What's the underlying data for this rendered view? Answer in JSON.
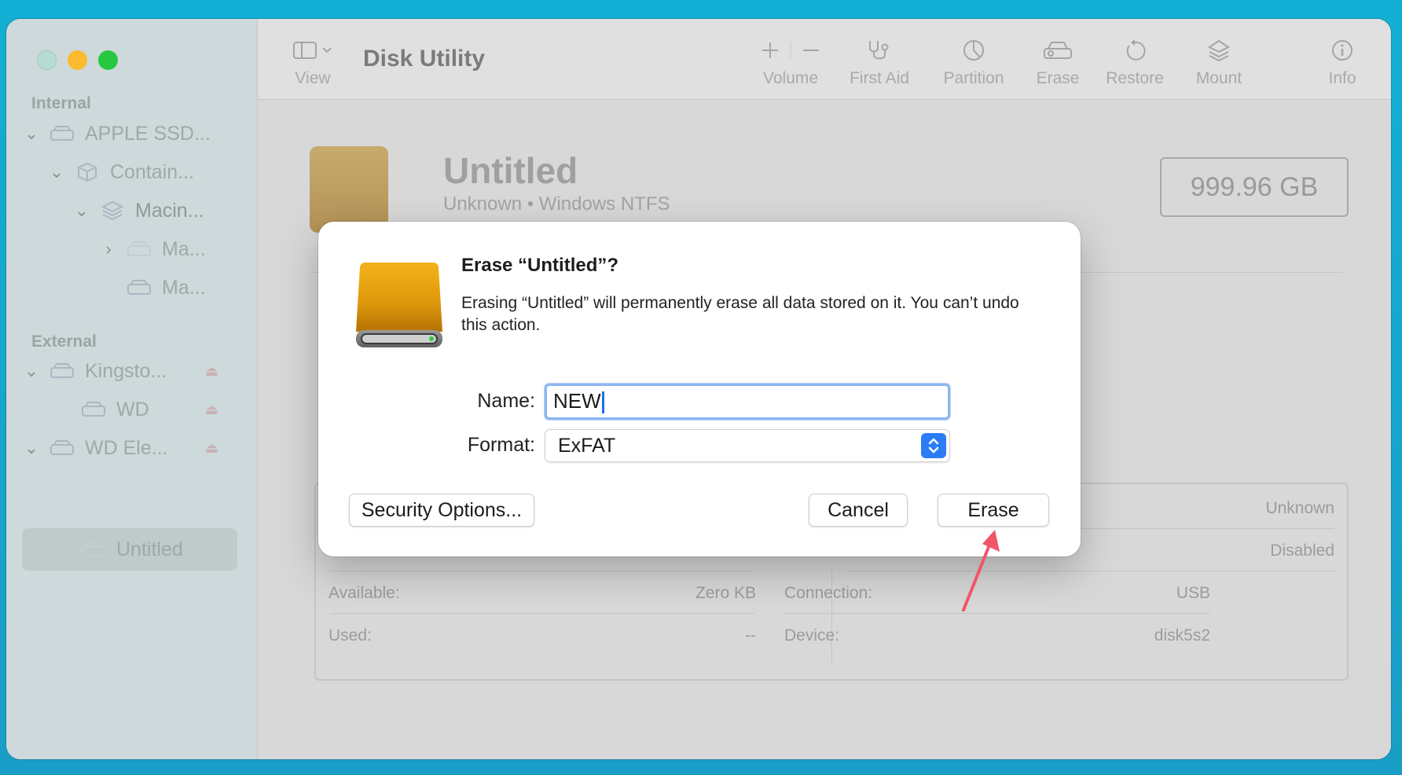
{
  "window": {
    "title": "Disk Utility",
    "view_label": "View"
  },
  "toolbar": {
    "buttons": [
      {
        "label": "Volume",
        "icon": "plus-minus-icon"
      },
      {
        "label": "First Aid",
        "icon": "stethoscope-icon"
      },
      {
        "label": "Partition",
        "icon": "pie-chart-icon"
      },
      {
        "label": "Erase",
        "icon": "eraser-icon"
      },
      {
        "label": "Restore",
        "icon": "restore-icon"
      },
      {
        "label": "Mount",
        "icon": "mount-icon"
      },
      {
        "label": "Info",
        "icon": "info-icon"
      }
    ]
  },
  "sidebar": {
    "internal_label": "Internal",
    "external_label": "External",
    "items": [
      {
        "label": "APPLE SSD...",
        "icon": "drive-icon",
        "expanded": true
      },
      {
        "label": "Contain...",
        "icon": "container-icon",
        "expanded": true
      },
      {
        "label": "Macin...",
        "icon": "layers-icon",
        "expanded": true
      },
      {
        "label": "Ma...",
        "icon": "volume-icon",
        "expanded": false
      },
      {
        "label": "Ma...",
        "icon": "volume-icon"
      },
      {
        "label": "Kingsto...",
        "icon": "drive-icon",
        "expanded": true,
        "eject": true
      },
      {
        "label": "WD",
        "icon": "volume-icon",
        "eject": true
      },
      {
        "label": "WD Ele...",
        "icon": "drive-icon",
        "expanded": true,
        "eject": true
      },
      {
        "label": "Untitled",
        "icon": "volume-icon",
        "selected": true
      }
    ]
  },
  "volume": {
    "name": "Untitled",
    "subtitle": "Unknown • Windows NTFS",
    "size": "999.96 GB"
  },
  "info": {
    "right_top_1": "Unknown",
    "right_top_2": "Disabled",
    "available_label": "Available:",
    "available_value": "Zero KB",
    "used_label": "Used:",
    "used_value": "--",
    "connection_label": "Connection:",
    "connection_value": "USB",
    "device_label": "Device:",
    "device_value": "disk5s2"
  },
  "dialog": {
    "title": "Erase “Untitled”?",
    "message": "Erasing “Untitled” will permanently erase all data stored on it. You can’t undo this action.",
    "name_label": "Name:",
    "name_value": "NEW",
    "format_label": "Format:",
    "format_value": "ExFAT",
    "security_button": "Security Options...",
    "cancel_button": "Cancel",
    "erase_button": "Erase"
  },
  "colors": {
    "accent": "#2b7cf6",
    "annotation_arrow": "#f0566a",
    "traffic_min": "#fbbb2e",
    "traffic_max": "#27c840"
  }
}
